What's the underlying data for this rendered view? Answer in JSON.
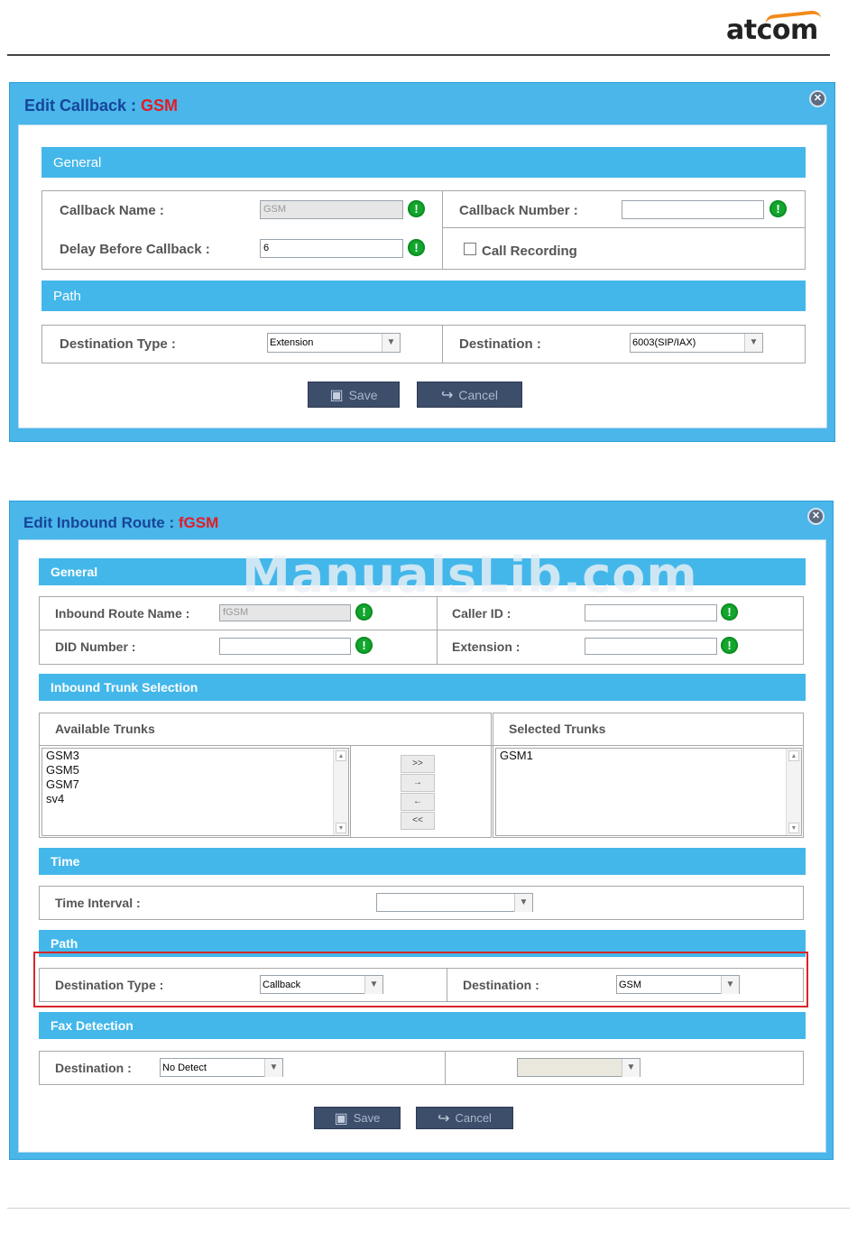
{
  "header": {
    "logo": "atcom"
  },
  "callback_dialog": {
    "title": "Edit Callback : ",
    "title_accent": "GSM",
    "close_icon": "close-icon",
    "section_general": "General",
    "callback_name_label": "Callback Name :",
    "callback_name_value": "GSM",
    "callback_number_label": "Callback Number :",
    "callback_number_value": "",
    "delay_label": "Delay Before Callback :",
    "delay_value": "6",
    "call_recording_label": "Call Recording",
    "call_recording_checked": false,
    "section_path": "Path",
    "destination_type_label": "Destination Type :",
    "destination_type_value": "Extension",
    "destination_label": "Destination :",
    "destination_value": "6003(SIP/IAX)",
    "save_label": "Save",
    "cancel_label": "Cancel"
  },
  "inbound_dialog": {
    "title": "Edit Inbound Route : ",
    "title_accent": "fGSM",
    "close_icon": "close-icon",
    "section_general": "General",
    "route_name_label": "Inbound Route Name :",
    "route_name_value": "fGSM",
    "caller_id_label": "Caller ID :",
    "caller_id_value": "",
    "did_label": "DID Number :",
    "did_value": "",
    "extension_label": "Extension :",
    "extension_value": "",
    "section_trunks": "Inbound Trunk Selection",
    "available_label": "Available Trunks",
    "available_trunks": [
      "GSM3",
      "GSM5",
      "GSM7",
      "sv4"
    ],
    "selected_label": "Selected Trunks",
    "selected_trunks": [
      "GSM1"
    ],
    "move_buttons": [
      ">>",
      "→",
      "←",
      "<<"
    ],
    "section_time": "Time",
    "time_interval_label": "Time Interval :",
    "time_interval_value": "",
    "section_path": "Path",
    "destination_type_label": "Destination Type :",
    "destination_type_value": "Callback",
    "destination_label": "Destination :",
    "destination_value": "GSM",
    "section_fax": "Fax Detection",
    "fax_destination_label": "Destination :",
    "fax_destination_value": "No Detect",
    "fax_second_value": "",
    "save_label": "Save",
    "cancel_label": "Cancel"
  },
  "watermark": "ManualsLib.com",
  "colors": {
    "dialog_border": "#4ab6ea",
    "section": "#44b7ea",
    "title": "#16459a",
    "accent": "#e51b24",
    "required": "#12a62d",
    "button": "#3d4e6b",
    "highlight": "#d8252b"
  }
}
